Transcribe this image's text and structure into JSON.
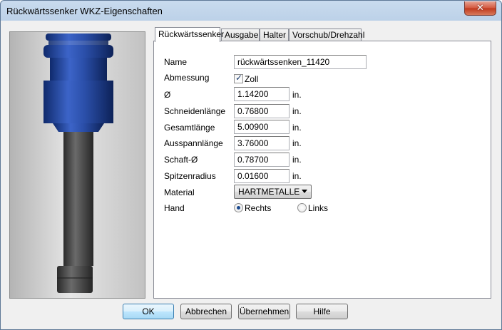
{
  "window": {
    "title": "Rückwärtssenker WKZ-Eigenschaften",
    "close_glyph": "✕"
  },
  "tabs": [
    {
      "label": "Rückwärtssenker",
      "active": true
    },
    {
      "label": "Ausgabe",
      "active": false
    },
    {
      "label": "Halter",
      "active": false
    },
    {
      "label": "Vorschub/Drehzahl",
      "active": false
    }
  ],
  "form": {
    "name": {
      "label": "Name",
      "value": "rückwärtssenken_11420"
    },
    "abmessung": {
      "label": "Abmessung",
      "checkbox_label": "Zoll",
      "checked": true
    },
    "diameter": {
      "label": "Ø",
      "value": "1.14200",
      "unit": "in."
    },
    "schneidenlaenge": {
      "label": "Schneidenlänge",
      "value": "0.76800",
      "unit": "in."
    },
    "gesamtlaenge": {
      "label": "Gesamtlänge",
      "value": "5.00900",
      "unit": "in."
    },
    "ausspannlaenge": {
      "label": "Ausspannlänge",
      "value": "3.76000",
      "unit": "in."
    },
    "schaft": {
      "label": "Schaft-Ø",
      "value": "0.78700",
      "unit": "in."
    },
    "spitzenradius": {
      "label": "Spitzenradius",
      "value": "0.01600",
      "unit": "in."
    },
    "material": {
      "label": "Material",
      "selected": "HARTMETALLE"
    },
    "hand": {
      "label": "Hand",
      "options": [
        "Rechts",
        "Links"
      ],
      "selected": "Rechts"
    }
  },
  "buttons": {
    "ok": "OK",
    "cancel": "Abbrechen",
    "apply": "Übernehmen",
    "help": "Hilfe"
  },
  "colors": {
    "tool_blue": "#1f3f8f",
    "tool_shaft": "#4a4a4a",
    "default_button_border": "#3c7fb1"
  },
  "preview": {
    "icon": "tool-3d-preview"
  }
}
